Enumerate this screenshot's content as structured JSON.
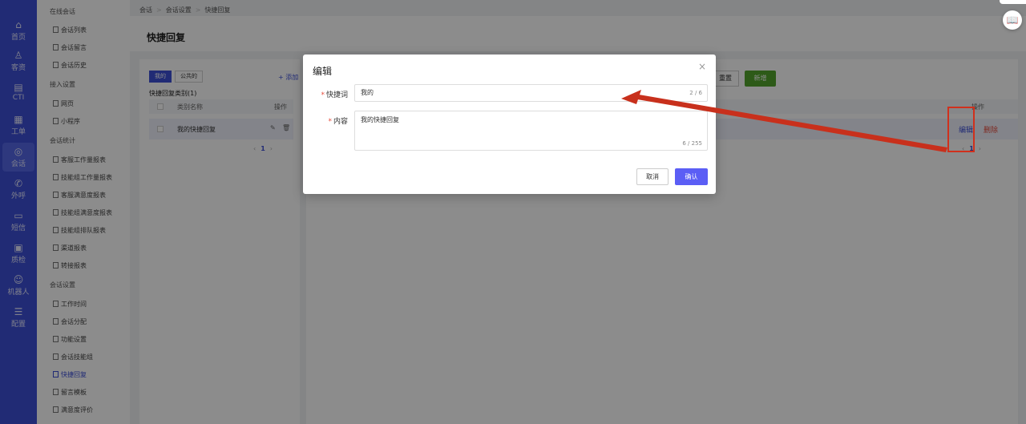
{
  "nav": {
    "items": [
      {
        "label": "首页",
        "icon": "home-icon"
      },
      {
        "label": "客资",
        "icon": "customer-icon"
      },
      {
        "label": "CTI",
        "icon": "cti-icon"
      },
      {
        "label": "工单",
        "icon": "ticket-icon"
      },
      {
        "label": "会话",
        "icon": "chat-icon",
        "active": true
      },
      {
        "label": "外呼",
        "icon": "phone-icon"
      },
      {
        "label": "短信",
        "icon": "sms-icon"
      },
      {
        "label": "质检",
        "icon": "quality-icon"
      },
      {
        "label": "机器人",
        "icon": "robot-icon"
      },
      {
        "label": "配置",
        "icon": "config-icon"
      }
    ]
  },
  "sidebar": {
    "groups": [
      {
        "title": "在线会话",
        "items": [
          "会话列表",
          "会话留言",
          "会话历史"
        ]
      },
      {
        "title": "接入设置",
        "items": [
          "网页",
          "小程序"
        ]
      },
      {
        "title": "会话统计",
        "items": [
          "客服工作量报表",
          "技能组工作量报表",
          "客服满意度报表",
          "技能组满意度报表",
          "技能组排队报表",
          "渠道报表",
          "转接报表"
        ]
      },
      {
        "title": "会话设置",
        "items": [
          "工作时间",
          "会话分配",
          "功能设置",
          "会话技能组",
          "快捷回复",
          "留言模板",
          "满意度评价"
        ]
      }
    ],
    "active_item": "快捷回复"
  },
  "breadcrumb": [
    "会话",
    "会话设置",
    "快捷回复"
  ],
  "page_title": "快捷回复",
  "left_panel": {
    "tabs": [
      "我的",
      "公共的"
    ],
    "active_tab": "我的",
    "add_label": "+ 添加",
    "category_title": "快捷回复类别(1)",
    "columns": [
      "类别名称",
      "操作"
    ],
    "rows": [
      {
        "name": "我的快捷回复"
      }
    ],
    "pager": {
      "prev": "‹",
      "page": "1",
      "next": "›"
    }
  },
  "right_panel": {
    "reset_label": "重置",
    "new_label": "新增",
    "op_column": "操作",
    "edit_label": "编辑",
    "delete_label": "删除",
    "pager": {
      "prev": "‹",
      "page": "1",
      "next": "›"
    }
  },
  "modal": {
    "title": "编辑",
    "close_icon": "×",
    "fields": {
      "shortcut": {
        "label": "快捷词",
        "value": "我的",
        "counter": "2 / 6"
      },
      "content": {
        "label": "内容",
        "value": "我的快捷回复",
        "counter": "6 / 255"
      }
    },
    "cancel_label": "取消",
    "confirm_label": "确认"
  },
  "colors": {
    "accent": "#3d4fd6",
    "danger": "#e74c3c",
    "success": "#52a52d",
    "annotation": "#d0301c"
  }
}
